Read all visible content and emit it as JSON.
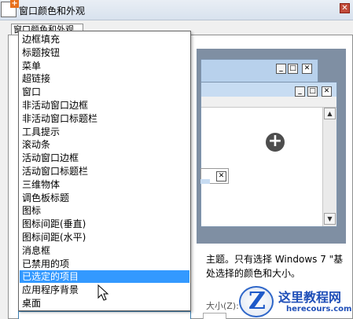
{
  "window": {
    "title": "窗口颜色和外观",
    "app_icon": "window-color-icon",
    "close_glyph": "✕"
  },
  "tabs": [
    {
      "label": "窗口颜色和外观"
    }
  ],
  "preview": {
    "controls": {
      "minimize": "_",
      "maximize": "□",
      "close": "✕"
    },
    "scroll_up": "▲",
    "scroll_down": "▼",
    "cursor_icon": "move-cursor-icon"
  },
  "item_dropdown": {
    "options": [
      "边框填充",
      "标题按钮",
      "菜单",
      "超链接",
      "窗口",
      "非活动窗口边框",
      "非活动窗口标题栏",
      "工具提示",
      "滚动条",
      "活动窗口边框",
      "活动窗口标题栏",
      "三维物体",
      "调色板标题",
      "图标",
      "图标间距(垂直)",
      "图标间距(水平)",
      "消息框",
      "已禁用的项",
      "已选定的项目",
      "应用程序背景",
      "桌面"
    ],
    "selected_index": 18
  },
  "description": {
    "line1": "主题。只有选择 Windows 7 \"基",
    "line2": "处选择的颜色和大小。"
  },
  "size_label": "大小(Z):",
  "colors": {
    "selection": "#3399ff",
    "preview_bg": "#7f8fa3",
    "title_bar": "#c7dcf2"
  },
  "watermark": {
    "logo_letter": "Z",
    "title": "这里教程网",
    "url": "herecours.com"
  }
}
